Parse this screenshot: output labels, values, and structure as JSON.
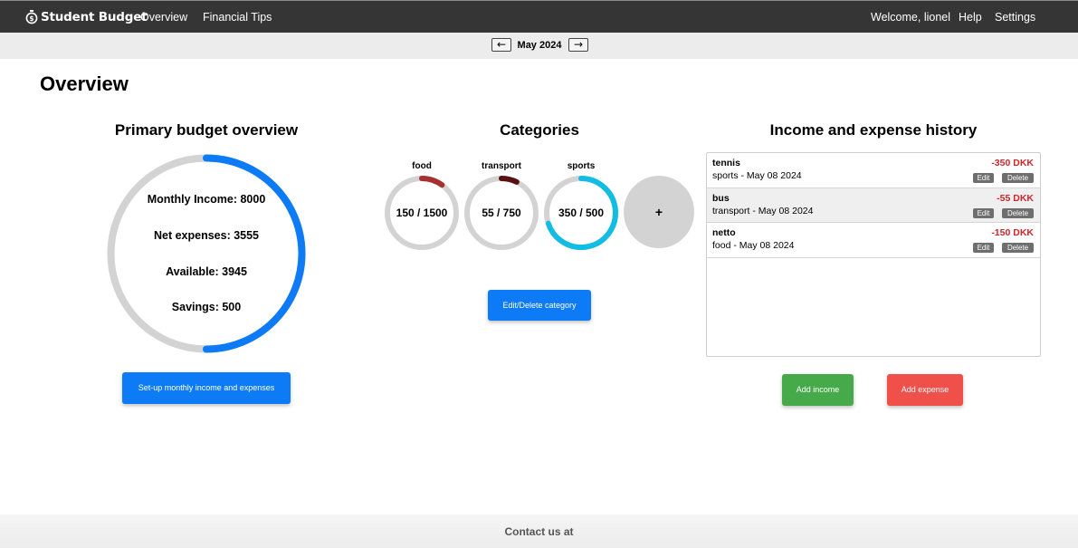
{
  "navbar": {
    "brand": "Student Budget",
    "links": [
      "Overview",
      "Financial Tips"
    ],
    "welcome": "Welcome, lionel",
    "help": "Help",
    "settings": "Settings"
  },
  "month": {
    "prev": "←",
    "label": "May 2024",
    "next": "→"
  },
  "page_title": "Overview",
  "budget": {
    "title": "Primary budget overview",
    "lines": [
      "Monthly Income: 8000",
      "Net expenses: 3555",
      "Available: 3945",
      "Savings: 500"
    ],
    "ring_fraction": 0.5,
    "ring_color": "#0d7bf5",
    "setup_button": "Set-up monthly income and expenses"
  },
  "categories": {
    "title": "Categories",
    "items": [
      {
        "name": "food",
        "value": "150 / 1500",
        "fraction": 0.1,
        "color": "#a8302e"
      },
      {
        "name": "transport",
        "value": "55 / 750",
        "fraction": 0.0733,
        "color": "#5a0f10"
      },
      {
        "name": "sports",
        "value": "350 / 500",
        "fraction": 0.7,
        "color": "#12bde3"
      }
    ],
    "add_label": "+",
    "edit_button": "Edit/Delete category"
  },
  "history": {
    "title": "Income and expense history",
    "rows": [
      {
        "name": "tennis",
        "sub": "sports - May 08 2024",
        "amount": "-350 DKK"
      },
      {
        "name": "bus",
        "sub": "transport - May 08 2024",
        "amount": "-55 DKK"
      },
      {
        "name": "netto",
        "sub": "food - May 08 2024",
        "amount": "-150 DKK"
      }
    ],
    "edit_label": "Edit",
    "delete_label": "Delete",
    "add_income": "Add income",
    "add_expense": "Add expense"
  },
  "footer": {
    "text": "Contact us at"
  }
}
